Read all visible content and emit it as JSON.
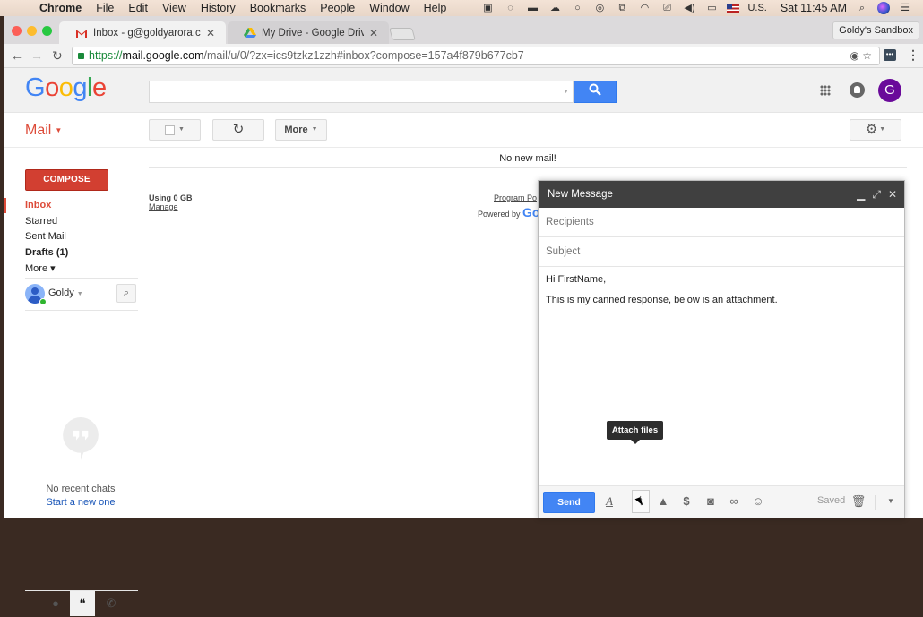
{
  "menubar": {
    "app": "Chrome",
    "items": [
      "File",
      "Edit",
      "View",
      "History",
      "Bookmarks",
      "People",
      "Window",
      "Help"
    ],
    "status": {
      "icons": [
        "facetime-icon",
        "skype-icon",
        "display-icon",
        "cloud-icon",
        "circle-icon",
        "creative-cloud-icon",
        "copy-icon",
        "wifi-icon",
        "airplay-icon",
        "volume-icon",
        "battery-icon",
        "flag-icon"
      ],
      "input_source": "U.S.",
      "clock": "Sat 11:45 AM"
    }
  },
  "browser": {
    "tabs": [
      {
        "title": "Inbox - g@goldyarora.com - G",
        "favicon": "gmail-icon",
        "active": true
      },
      {
        "title": "My Drive - Google Drive",
        "favicon": "drive-icon",
        "active": false
      }
    ],
    "profile": "Goldy's Sandbox",
    "url": {
      "scheme": "https://",
      "host": "mail.google.com",
      "path": "/mail/u/0/?zx=ics9tzkz1zzh#inbox?compose=157a4f879b677cb7"
    }
  },
  "gmail": {
    "logo": [
      "G",
      "o",
      "o",
      "g",
      "l",
      "e"
    ],
    "search_placeholder": "",
    "avatar_letter": "G",
    "mail_label": "Mail",
    "toolbar": {
      "more_label": "More"
    },
    "compose_label": "COMPOSE",
    "nav": [
      {
        "label": "Inbox",
        "state": "active"
      },
      {
        "label": "Starred",
        "state": "normal"
      },
      {
        "label": "Sent Mail",
        "state": "normal"
      },
      {
        "label": "Drafts (1)",
        "state": "bold"
      },
      {
        "label": "More ▾",
        "state": "normal"
      }
    ],
    "chat": {
      "user": "Goldy",
      "no_chats": "No recent chats",
      "start_new": "Start a new one"
    },
    "content": {
      "no_mail": "No new mail!",
      "storage": "Using 0 GB",
      "manage": "Manage",
      "program": "Program Po",
      "powered_by": "Powered by",
      "powered_logo": "Go"
    }
  },
  "compose": {
    "title": "New Message",
    "recipients_placeholder": "Recipients",
    "subject_placeholder": "Subject",
    "body": [
      "Hi FirstName,",
      "This is my canned response, below is an attachment."
    ],
    "send_label": "Send",
    "saved_label": "Saved",
    "tooltip": "Attach files"
  }
}
